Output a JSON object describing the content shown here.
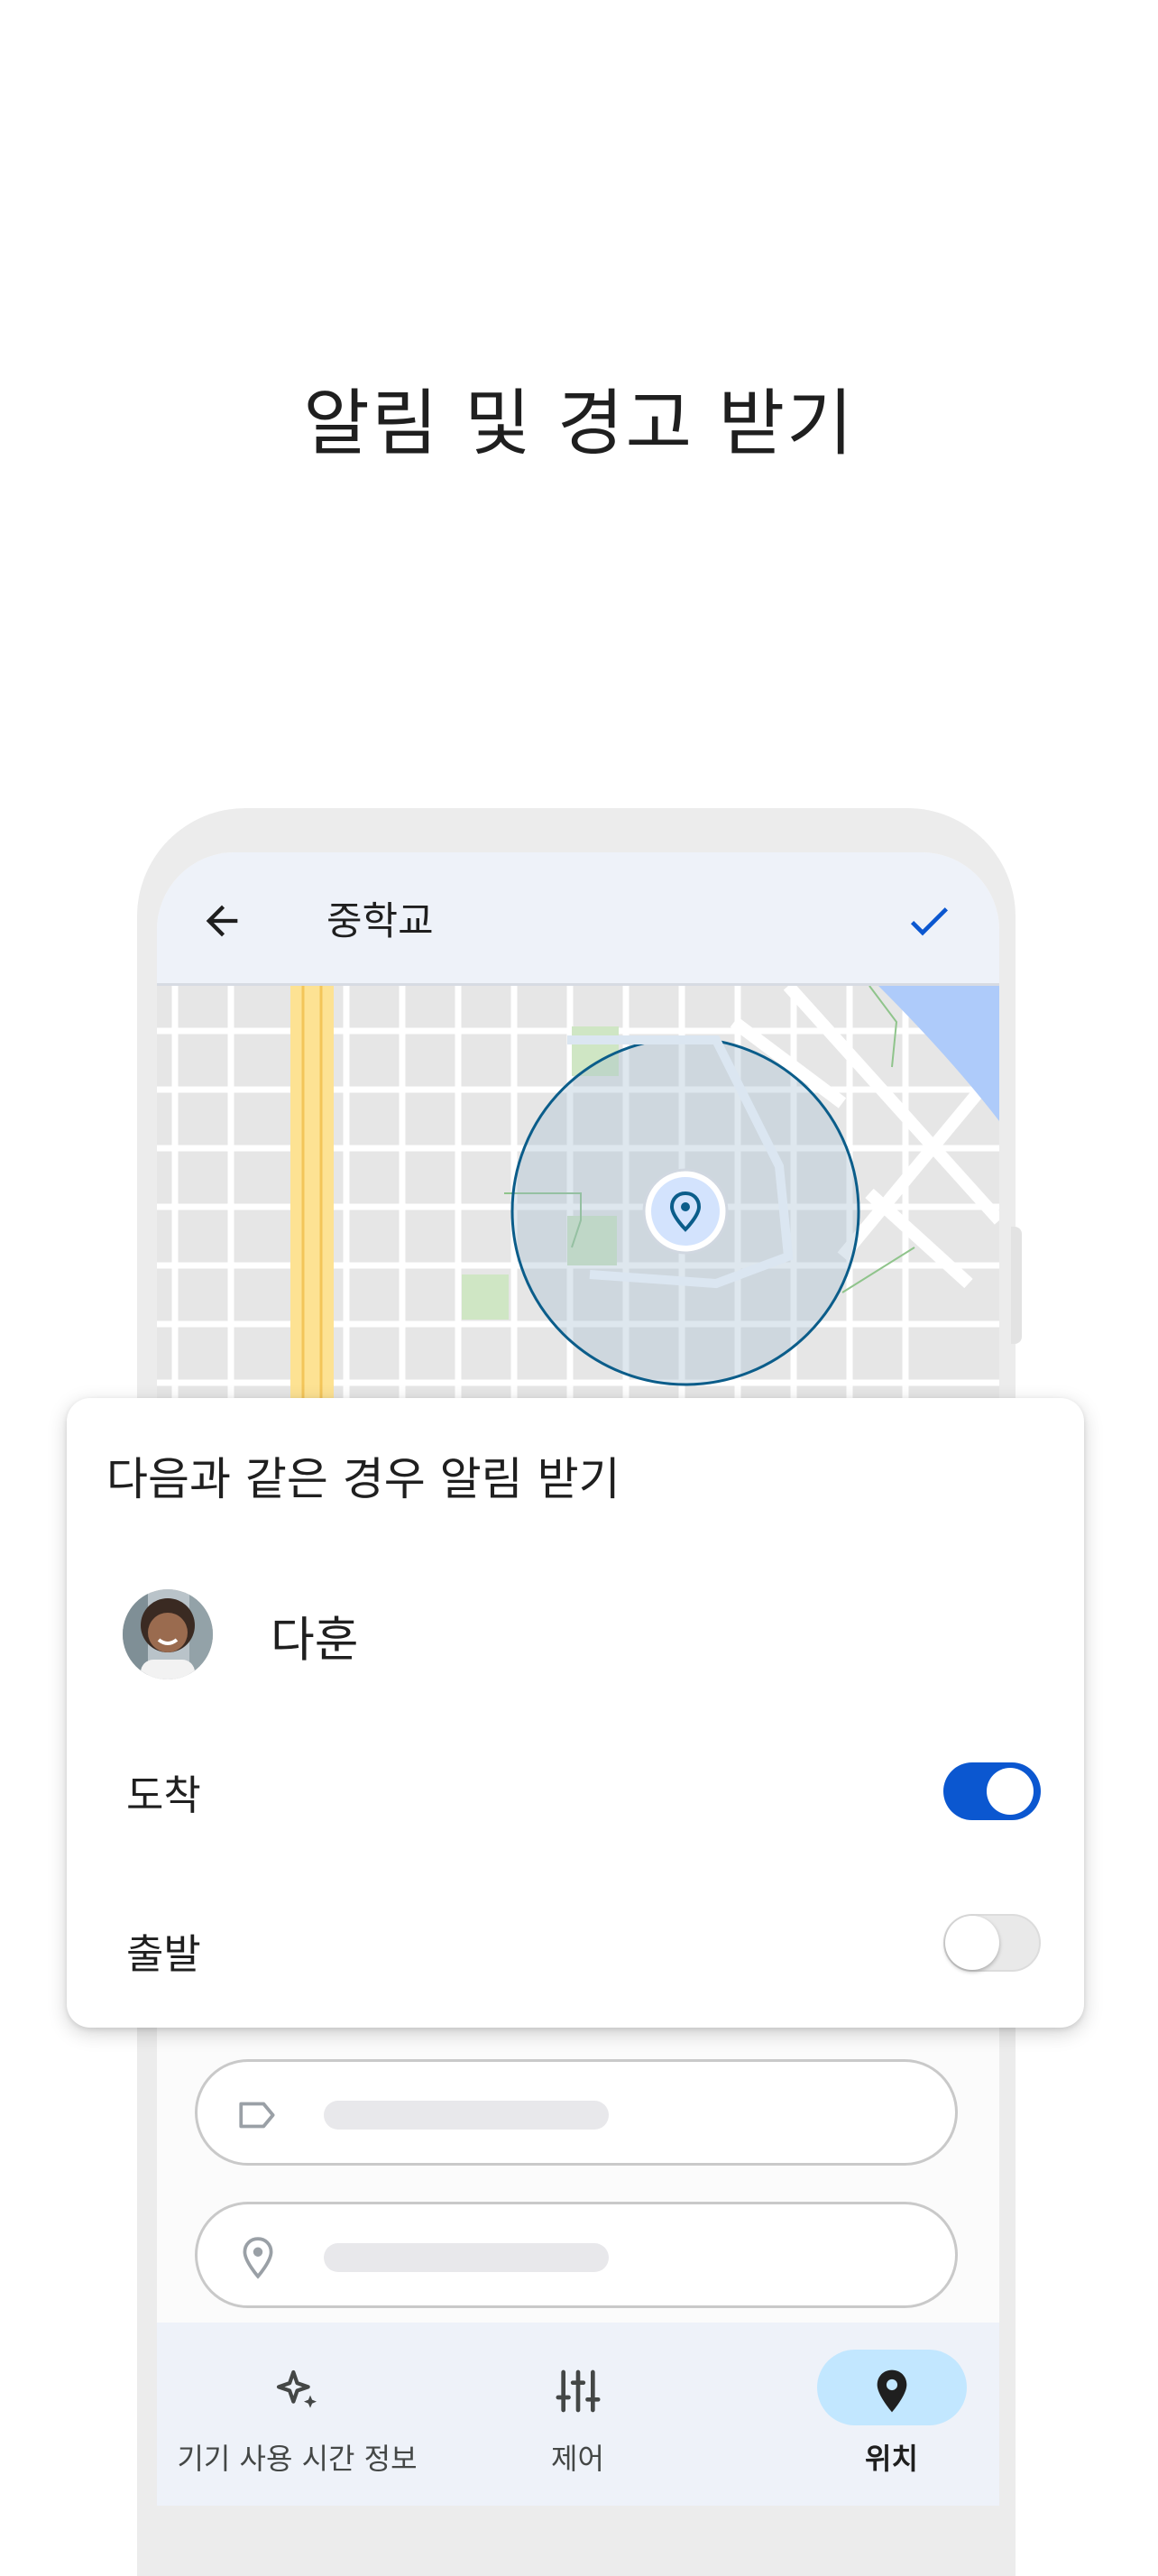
{
  "headline": "알림 및 경고 받기",
  "app_bar": {
    "title": "중학교",
    "back_icon": "arrow-back-icon",
    "confirm_icon": "check-icon",
    "accent_color": "#0b57d0"
  },
  "map": {
    "place_marker_icon": "location-pin-icon",
    "geofence_color": "#0b5d8a"
  },
  "notify_card": {
    "title": "다음과 같은 경우 알림 받기",
    "person": {
      "name": "다훈",
      "avatar_icon": "child-avatar"
    },
    "options": [
      {
        "label": "도착",
        "enabled": true
      },
      {
        "label": "출발",
        "enabled": false
      }
    ]
  },
  "form_fields": [
    {
      "icon": "label-tag-icon",
      "value": ""
    },
    {
      "icon": "location-outline-icon",
      "value": ""
    }
  ],
  "bottom_nav": {
    "items": [
      {
        "label": "기기 사용 시간 정보",
        "icon": "sparkle-icon",
        "active": false
      },
      {
        "label": "제어",
        "icon": "tune-sliders-icon",
        "active": false
      },
      {
        "label": "위치",
        "icon": "location-pin-filled-icon",
        "active": true
      }
    ],
    "active_pill_color": "#c2e7ff"
  }
}
